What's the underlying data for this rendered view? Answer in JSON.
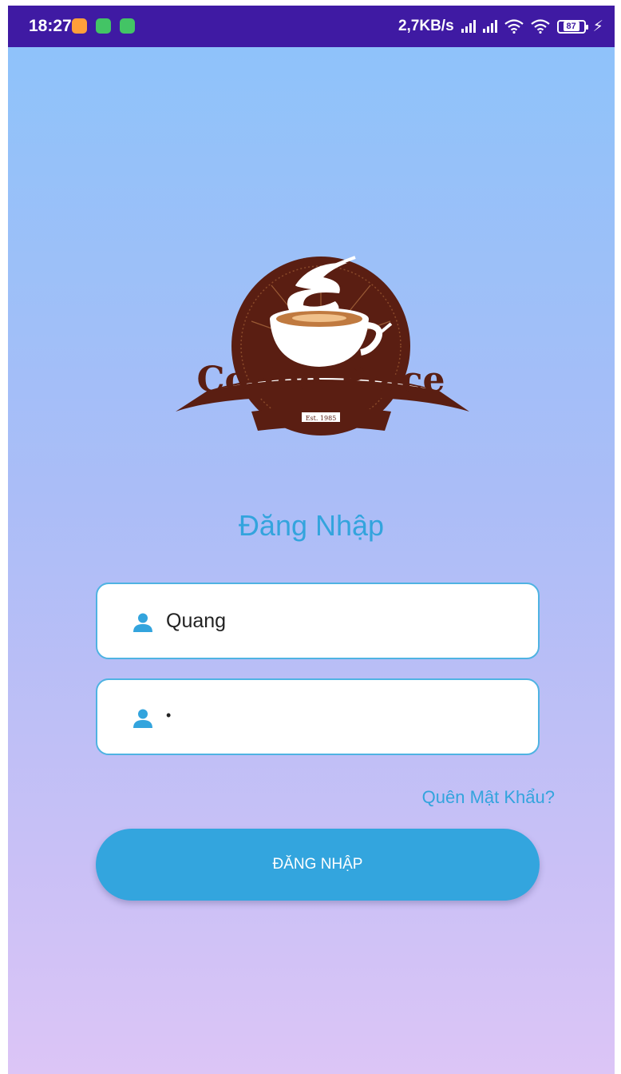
{
  "status_bar": {
    "time": "18:27",
    "net_speed": "2,7KB/s",
    "battery": "87",
    "notification_colors": [
      "#ff9f3a",
      "#43c465",
      "#43c465"
    ]
  },
  "logo": {
    "brand": "Coffee Place",
    "brand_word_1": "Coffee",
    "brand_word_2": "Place",
    "established": "Est. 1985"
  },
  "login": {
    "title": "Đăng Nhập",
    "username_value": "Quang",
    "password_value": "•",
    "forgot_label": "Quên Mật Khẩu?",
    "submit_label": "ĐĂNG NHẬP"
  },
  "colors": {
    "accent": "#33a5de",
    "status_bar": "#3f1aa3",
    "logo_brown": "#5a1e12"
  },
  "icons": [
    "person-icon",
    "signal-icon",
    "wifi-icon",
    "battery-icon"
  ]
}
